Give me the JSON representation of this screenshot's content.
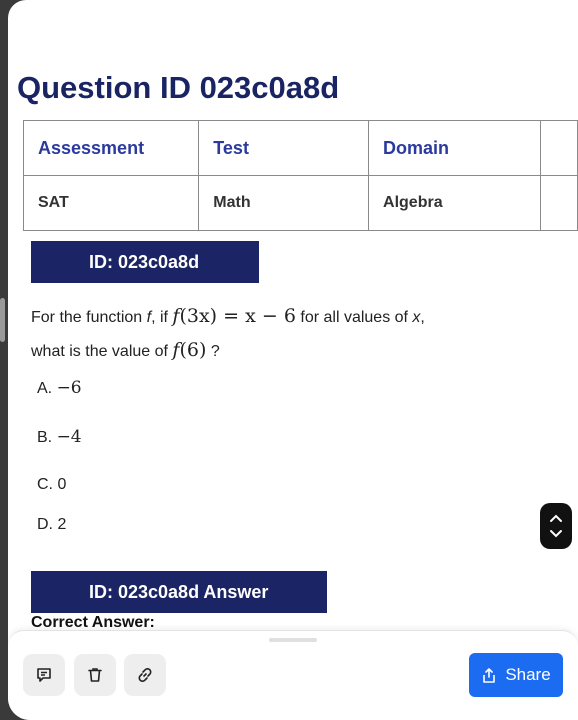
{
  "page": {
    "title": "Question ID 023c0a8d"
  },
  "info_table": {
    "headers": [
      "Assessment",
      "Test",
      "Domain"
    ],
    "values": [
      "SAT",
      "Math",
      "Algebra"
    ]
  },
  "question": {
    "banner": "ID: 023c0a8d",
    "line1_pre": "For the function ",
    "line1_f": "f",
    "line1_mid": ", if ",
    "line1_expr_f": "f",
    "line1_expr_arg": "(3x)",
    "line1_expr_rest": " = x − 6",
    "line1_post": " for all values of ",
    "line1_x": "x",
    "line1_end": ",",
    "line2_pre": "what is the value of ",
    "line2_expr_f": "f",
    "line2_expr_arg": "(6)",
    "line2_end": " ?",
    "options": [
      {
        "letter": "A. ",
        "value": "−6"
      },
      {
        "letter": "B. ",
        "value": "−4"
      },
      {
        "letter": "C. ",
        "value": "0"
      },
      {
        "letter": "D. ",
        "value": "2"
      }
    ]
  },
  "answer": {
    "banner": "ID: 023c0a8d Answer",
    "correct_label": "Correct Answer:"
  },
  "toolbar": {
    "share_label": "Share",
    "icons": [
      "comment-icon",
      "trash-icon",
      "link-icon",
      "share-icon"
    ],
    "accent": "#1c6cf2"
  },
  "colors": {
    "title": "#1a2463",
    "banner_bg": "#1b2464",
    "table_header": "#2a3a9e"
  }
}
